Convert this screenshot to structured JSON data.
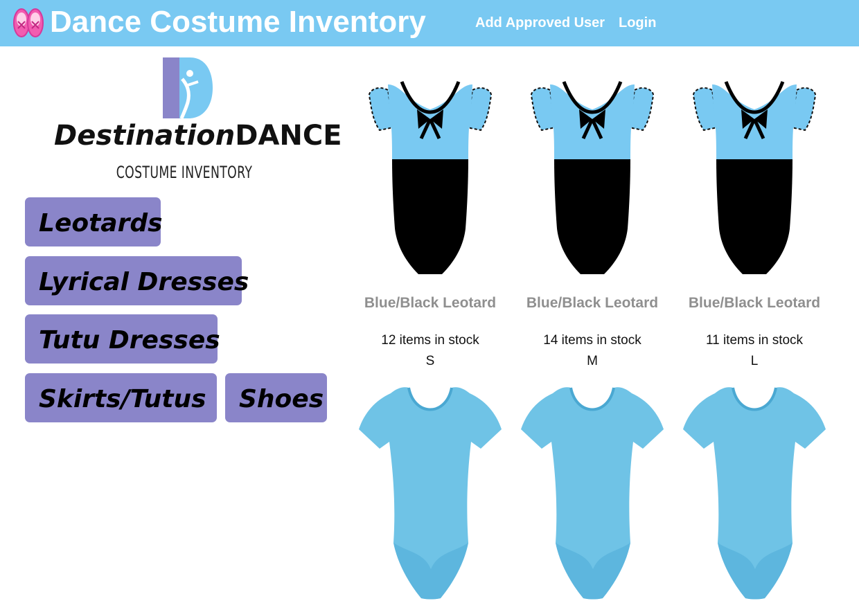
{
  "header": {
    "icon": "ballet-shoes-icon",
    "title": "Dance Costume Inventory",
    "nav": [
      {
        "label": "Add Approved User"
      },
      {
        "label": "Login"
      }
    ]
  },
  "logo": {
    "letter": "D",
    "name_script": "Destination",
    "name_bold": "DANCE",
    "subtitle": "COSTUME INVENTORY"
  },
  "categories": [
    {
      "label": "Leotards"
    },
    {
      "label": "Lyrical Dresses"
    },
    {
      "label": "Tutu Dresses"
    },
    {
      "label": "Skirts/Tutus"
    },
    {
      "label": "Shoes"
    }
  ],
  "products": [
    {
      "name": "Blue/Black Leotard",
      "stock": "12 items in stock",
      "size": "S",
      "image": "blue-black-leotard-image"
    },
    {
      "name": "Blue/Black Leotard",
      "stock": "14 items in stock",
      "size": "M",
      "image": "blue-black-leotard-image"
    },
    {
      "name": "Blue/Black Leotard",
      "stock": "11 items in stock",
      "size": "L",
      "image": "blue-black-leotard-image"
    }
  ],
  "products_row2": [
    {
      "image": "light-blue-leotard-image"
    },
    {
      "image": "light-blue-leotard-image"
    },
    {
      "image": "light-blue-leotard-image"
    }
  ],
  "colors": {
    "header_bg": "#79c9f2",
    "category_button": "#8a85c9",
    "product_name": "#8f8f8f",
    "leotard_blue": "#79c9f2",
    "leotard_black": "#000000",
    "logo_purple": "#8a85c9",
    "logo_blue": "#79c9f2"
  }
}
